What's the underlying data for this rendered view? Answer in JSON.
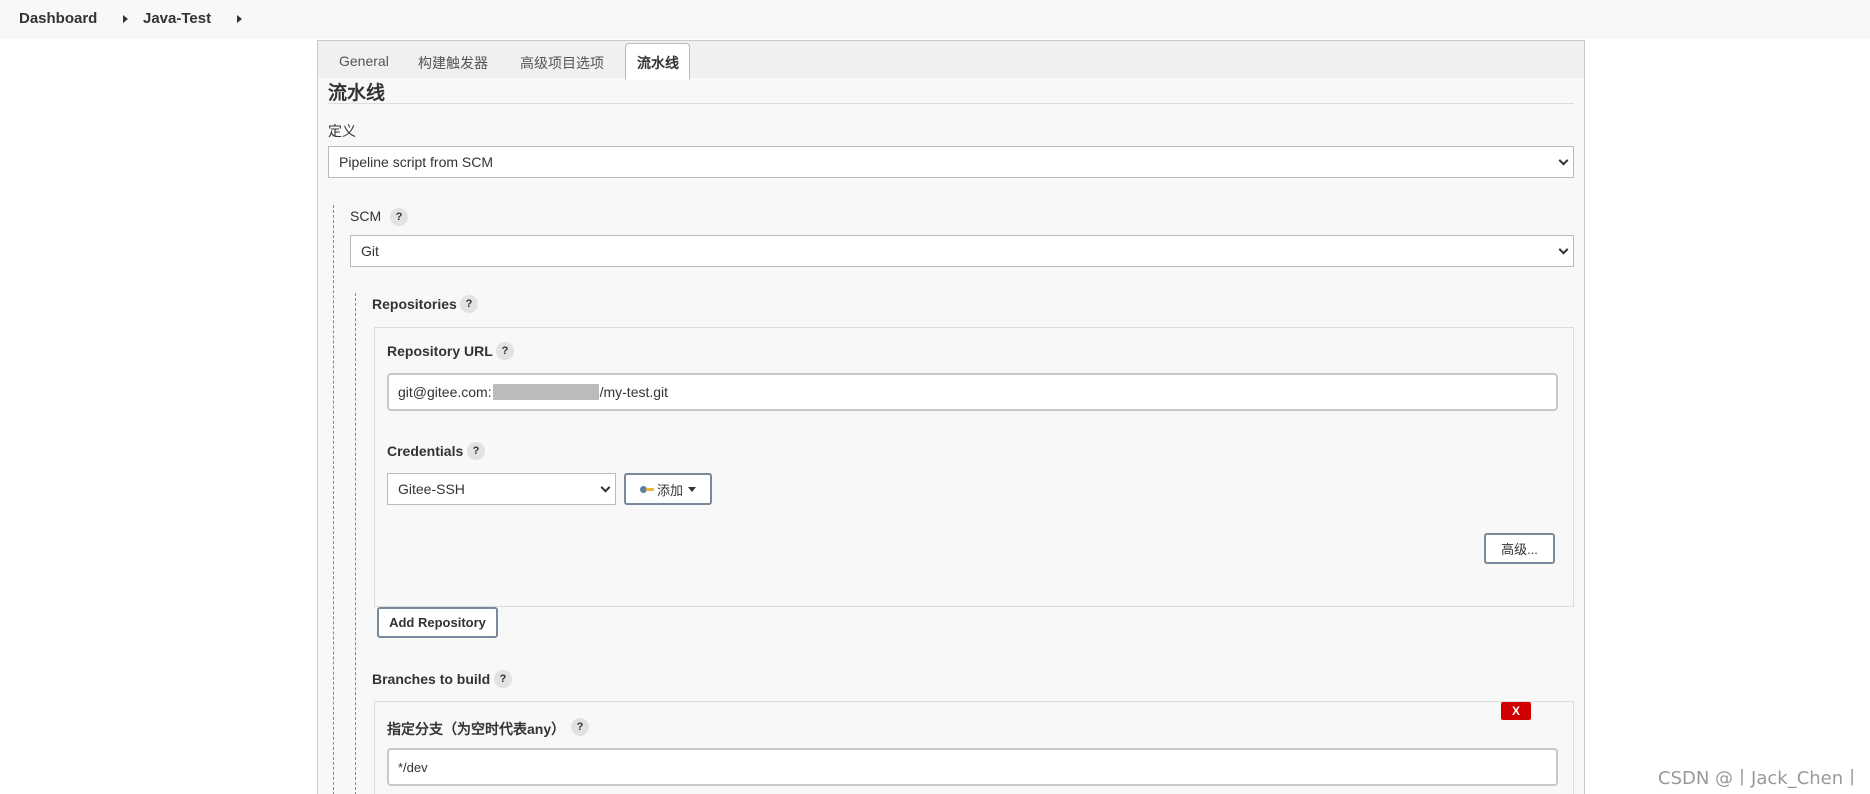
{
  "breadcrumb": {
    "items": [
      "Dashboard",
      "Java-Test"
    ]
  },
  "tabs": [
    "General",
    "构建触发器",
    "高级项目选项",
    "流水线"
  ],
  "section": {
    "title": "流水线",
    "definition_label": "定义",
    "definition_value": "Pipeline script from SCM"
  },
  "scm": {
    "label": "SCM",
    "value": "Git"
  },
  "repositories": {
    "label": "Repositories",
    "url_label": "Repository URL",
    "url_prefix": "git@gitee.com:",
    "url_suffix": "/my-test.git",
    "credentials_label": "Credentials",
    "credentials_value": "Gitee-SSH",
    "add_label": "添加",
    "advanced_label": "高级...",
    "add_repository_label": "Add Repository"
  },
  "branches": {
    "label": "Branches to build",
    "delete_label": "X",
    "specifier_label": "指定分支（为空时代表any）",
    "specifier_value": "*/dev"
  },
  "help_mark": "?",
  "watermark": "CSDN @丨Jack_Chen丨"
}
